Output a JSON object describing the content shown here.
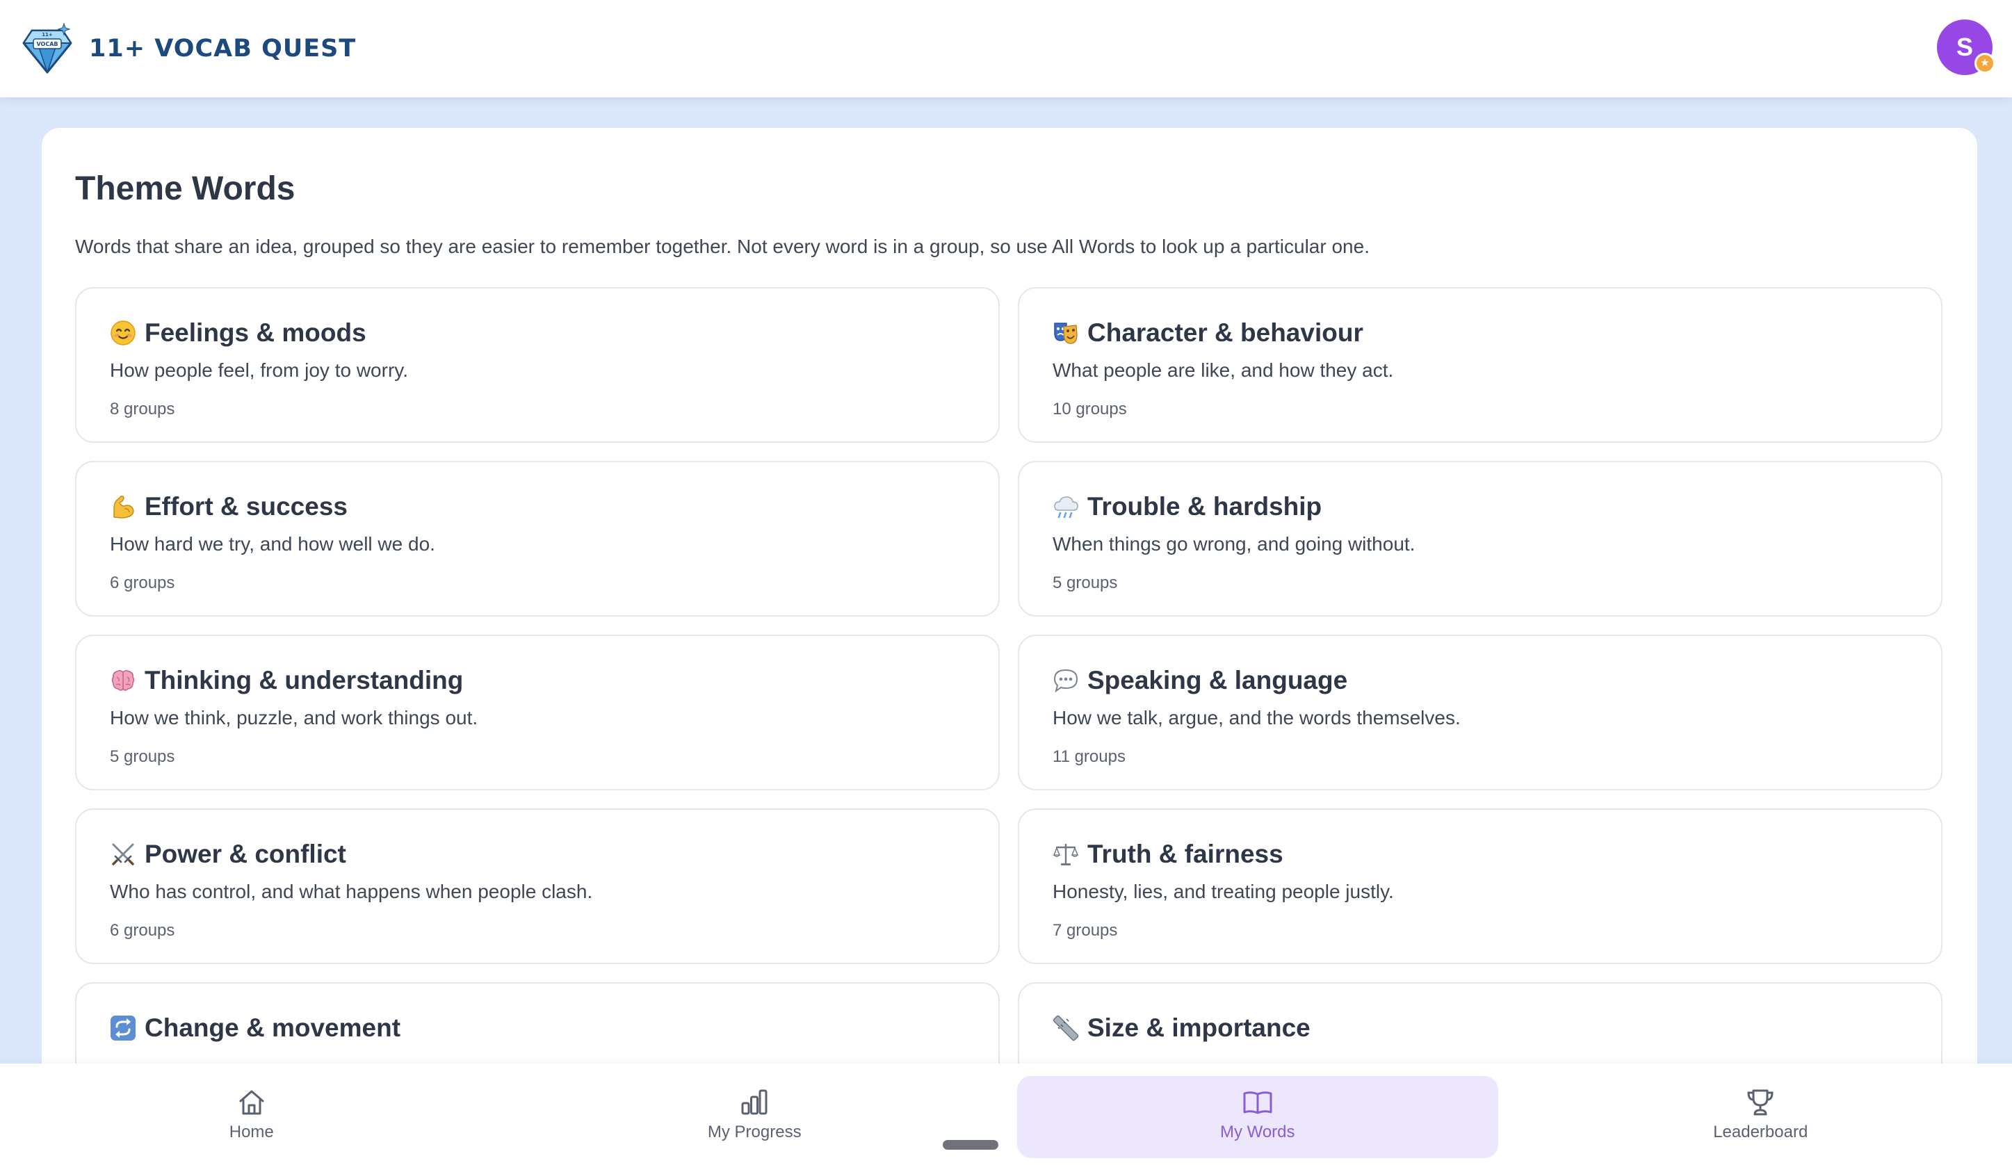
{
  "header": {
    "logo_text": "11+ VOCAB QUEST",
    "title": "11+ VOCAB QUEST",
    "avatar_initial": "S",
    "avatar_badge": "★"
  },
  "page": {
    "title": "Theme Words",
    "description": "Words that share an idea, grouped so they are easier to remember together. Not every word is in a group, so use All Words to look up a particular one."
  },
  "themes": [
    {
      "icon": "smiling-face-icon",
      "title": "Feelings & moods",
      "description": "How people feel, from joy to worry.",
      "count": "8 groups"
    },
    {
      "icon": "performing-arts-masks-icon",
      "title": "Character & behaviour",
      "description": "What people are like, and how they act.",
      "count": "10 groups"
    },
    {
      "icon": "flexed-biceps-icon",
      "title": "Effort & success",
      "description": "How hard we try, and how well we do.",
      "count": "6 groups"
    },
    {
      "icon": "rain-cloud-icon",
      "title": "Trouble & hardship",
      "description": "When things go wrong, and going without.",
      "count": "5 groups"
    },
    {
      "icon": "brain-icon",
      "title": "Thinking & understanding",
      "description": "How we think, puzzle, and work things out.",
      "count": "5 groups"
    },
    {
      "icon": "speech-bubble-icon",
      "title": "Speaking & language",
      "description": "How we talk, argue, and the words themselves.",
      "count": "11 groups"
    },
    {
      "icon": "crossed-swords-icon",
      "title": "Power & conflict",
      "description": "Who has control, and what happens when people clash.",
      "count": "6 groups"
    },
    {
      "icon": "balance-scale-icon",
      "title": "Truth & fairness",
      "description": "Honesty, lies, and treating people justly.",
      "count": "7 groups"
    },
    {
      "icon": "repeat-arrows-icon",
      "title": "Change & movement",
      "description": "",
      "count": ""
    },
    {
      "icon": "ruler-icon",
      "title": "Size & importance",
      "description": "",
      "count": ""
    }
  ],
  "nav": [
    {
      "icon": "home-icon",
      "label": "Home",
      "active": false
    },
    {
      "icon": "bar-chart-icon",
      "label": "My Progress",
      "active": false
    },
    {
      "icon": "open-book-icon",
      "label": "My Words",
      "active": true
    },
    {
      "icon": "trophy-icon",
      "label": "Leaderboard",
      "active": false
    }
  ],
  "colors": {
    "brand": "#1c4a7e",
    "avatar": "#9747e6",
    "nav_active": "#8b5bd6",
    "nav_active_bg": "#ede7fd",
    "background": "#dbe8fb"
  }
}
